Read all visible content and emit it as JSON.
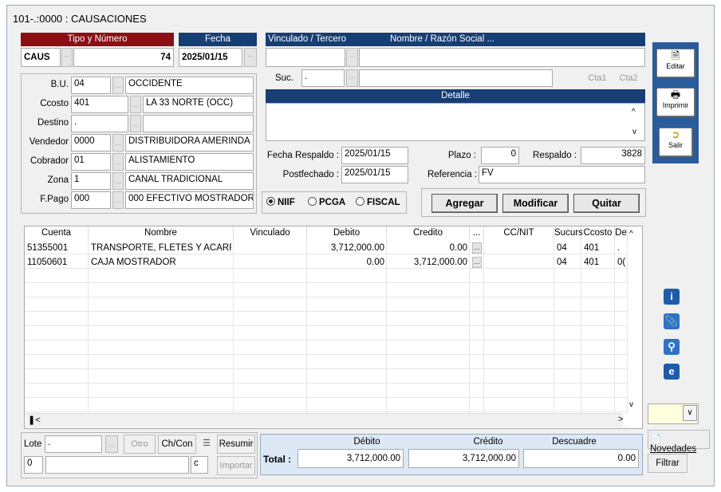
{
  "window": {
    "title": "101-.:0000 : CAUSACIONES"
  },
  "tipo": {
    "header": "Tipo y Número",
    "code": "CAUS",
    "number": "74",
    "fecha_header": "Fecha",
    "fecha": "2025/01/15",
    "dots": "..."
  },
  "tercero": {
    "header_vinculado": "Vinculado / Tercero",
    "header_nombre": "Nombre / Razón Social ...",
    "vinculado": "",
    "nombre": "",
    "suc_label": "Suc.",
    "suc": ".",
    "suc_nombre": "",
    "cta1": "Cta1",
    "cta2": "Cta2"
  },
  "detalle": {
    "header": "Detalle",
    "text": ""
  },
  "left_fields": [
    {
      "label": "B.U.",
      "code": "04",
      "name": "OCCIDENTE"
    },
    {
      "label": "Ccosto",
      "code": "401",
      "name": "LA 33 NORTE (OCC)"
    },
    {
      "label": "Destino",
      "code": ".",
      "name": ""
    },
    {
      "label": "Vendedor",
      "code": "0000",
      "name": "DISTRIBUIDORA AMERINDA"
    },
    {
      "label": "Cobrador",
      "code": "01",
      "name": "ALISTAMIENTO"
    },
    {
      "label": "Zona",
      "code": "1",
      "name": "CANAL TRADICIONAL"
    },
    {
      "label": "F.Pago",
      "code": "000",
      "name": "000 EFECTIVO MOSTRADOR"
    }
  ],
  "respaldo": {
    "fecha_label": "Fecha Respaldo :",
    "fecha": "2025/01/15",
    "post_label": "Postfechado :",
    "post": "2025/01/15",
    "plazo_label": "Plazo :",
    "plazo": "0",
    "respaldo_label": "Respaldo :",
    "respaldo": "3828",
    "ref_label": "Referencia :",
    "ref": "FV"
  },
  "normas": {
    "options": [
      "NIIF",
      "PCGA",
      "FISCAL"
    ],
    "selected": "NIIF"
  },
  "actions": {
    "agregar": "Agregar",
    "modificar": "Modificar",
    "quitar": "Quitar"
  },
  "toolbar": {
    "editar": "Editar",
    "imprimir": "Imprimir",
    "salir": "Salir"
  },
  "grid": {
    "columns": [
      "Cuenta",
      "Nombre",
      "Vinculado",
      "Debito",
      "Credito",
      "...",
      "CC/NIT",
      "Sucurs",
      "Ccosto",
      "De"
    ],
    "rows": [
      {
        "cuenta": "51355001",
        "nombre": "TRANSPORTE, FLETES Y ACARREO",
        "vinculado": "",
        "debito": "3,712,000.00",
        "credito": "0.00",
        "ccnit": "",
        "sucurs": "04",
        "ccosto": "401",
        "de": "."
      },
      {
        "cuenta": "11050601",
        "nombre": "CAJA MOSTRADOR",
        "vinculado": "",
        "debito": "0.00",
        "credito": "3,712,000.00",
        "ccnit": "",
        "sucurs": "04",
        "ccosto": "401",
        "de": "0("
      }
    ]
  },
  "bottom": {
    "lote_label": "Lote",
    "lote": ".",
    "otro": "Otro",
    "chcon": "Ch/Con",
    "resumir": "Resumir",
    "importar": "Importar",
    "num": "0",
    "field": "",
    "c": "c"
  },
  "totals": {
    "label": "Total :",
    "debito_header": "Débito",
    "credito_header": "Crédito",
    "descuadre_header": "Descuadre",
    "debito": "3,712,000.00",
    "credito": "3,712,000.00",
    "descuadre": "0.00"
  },
  "right": {
    "novedades": "Novedades",
    "filtrar": "Filtrar",
    "combo": ""
  },
  "colors": {
    "header_red": "#8b0f14",
    "header_blue": "#163e75",
    "toolbar_blue": "#2a5b9a"
  }
}
